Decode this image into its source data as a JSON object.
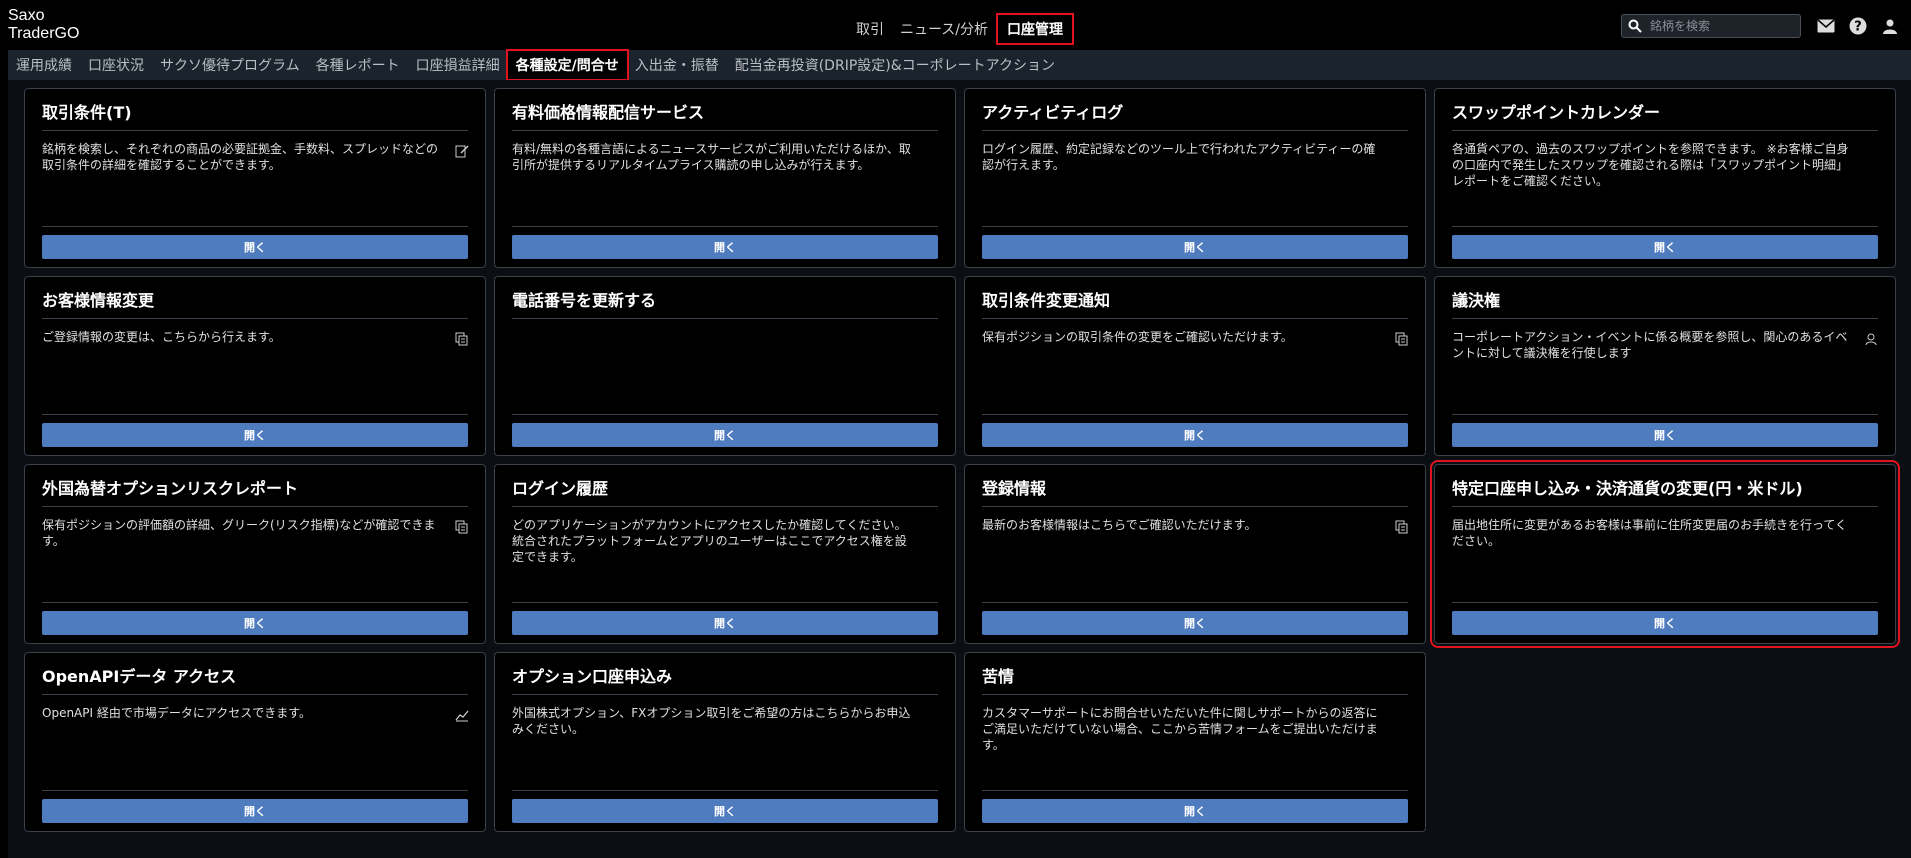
{
  "app": {
    "logo_line1": "Saxo",
    "logo_line2": "TraderGO"
  },
  "main_nav": [
    {
      "label": "取引",
      "active": false
    },
    {
      "label": "ニュース/分析",
      "active": false
    },
    {
      "label": "口座管理",
      "active": true
    }
  ],
  "search": {
    "placeholder": "銘柄を検索"
  },
  "sub_nav": [
    {
      "label": "運用成績",
      "active": false
    },
    {
      "label": "口座状況",
      "active": false
    },
    {
      "label": "サクソ優待プログラム",
      "active": false
    },
    {
      "label": "各種レポート",
      "active": false
    },
    {
      "label": "口座損益詳細",
      "active": false
    },
    {
      "label": "各種設定/問合せ",
      "active": true
    },
    {
      "label": "入出金・振替",
      "active": false
    },
    {
      "label": "配当金再投資(DRIP設定)&コーポレートアクション",
      "active": false
    }
  ],
  "cards": [
    {
      "title": "取引条件(T)",
      "desc": "銘柄を検索し、それぞれの商品の必要証拠金、手数料、スプレッドなどの取引条件の詳細を確認することができます。",
      "icon": "edit-icon",
      "button": "開く"
    },
    {
      "title": "有料価格情報配信サービス",
      "desc": "有料/無料の各種言語によるニュースサービスがご利用いただけるほか、取引所が提供するリアルタイムプライス購読の申し込みが行えます。",
      "icon": "",
      "button": "開く"
    },
    {
      "title": "アクティビティログ",
      "desc": "ログイン履歴、約定記録などのツール上で行われたアクティビティーの確認が行えます。",
      "icon": "",
      "button": "開く"
    },
    {
      "title": "スワップポイントカレンダー",
      "desc": "各通貨ペアの、過去のスワップポイントを参照できます。 ※お客様ご自身の口座内で発生したスワップを確認される際は「スワップポイント明細」レポートをご確認ください。",
      "icon": "",
      "button": "開く"
    },
    {
      "title": "お客様情報変更",
      "desc": "ご登録情報の変更は、こちらから行えます。",
      "icon": "copy-icon",
      "button": "開く"
    },
    {
      "title": "電話番号を更新する",
      "desc": "",
      "icon": "",
      "button": "開く"
    },
    {
      "title": "取引条件変更通知",
      "desc": "保有ポジションの取引条件の変更をご確認いただけます。",
      "icon": "copy-icon",
      "button": "開く"
    },
    {
      "title": "議決権",
      "desc": "コーポレートアクション・イベントに係る概要を参照し、関心のあるイベントに対して議決権を行使します",
      "icon": "user-icon",
      "button": "開く"
    },
    {
      "title": "外国為替オプションリスクレポート",
      "desc": "保有ポジションの評価額の詳細、グリーク(リスク指標)などが確認できます。",
      "icon": "copy-icon",
      "button": "開く"
    },
    {
      "title": "ログイン履歴",
      "desc": "どのアプリケーションがアカウントにアクセスしたか確認してください。 統合されたプラットフォームとアプリのユーザーはここでアクセス権を設定できます。",
      "icon": "",
      "button": "開く"
    },
    {
      "title": "登録情報",
      "desc": "最新のお客様情報はこちらでご確認いただけます。",
      "icon": "copy-icon",
      "button": "開く"
    },
    {
      "title": "特定口座申し込み・決済通貨の変更(円・米ドル)",
      "desc": "届出地住所に変更があるお客様は事前に住所変更届のお手続きを行ってください。",
      "icon": "",
      "button": "開く",
      "highlight": true
    },
    {
      "title": "OpenAPIデータ アクセス",
      "desc": "OpenAPI 経由で市場データにアクセスできます。",
      "icon": "chart-icon",
      "button": "開く"
    },
    {
      "title": "オプション口座申込み",
      "desc": "外国株式オプション、FXオプション取引をご希望の方はこちらからお申込みください。",
      "icon": "",
      "button": "開く"
    },
    {
      "title": "苦情",
      "desc": "カスタマーサポートにお問合せいただいた件に関しサポートからの返答にご満足いただけていない場合、ここから苦情フォームをご提出いただけます。",
      "icon": "",
      "button": "開く"
    }
  ],
  "colors": {
    "accent": "#4f7bbf",
    "highlight": "#e0141e",
    "background": "#000000",
    "subnav_bg": "#1b232c"
  }
}
